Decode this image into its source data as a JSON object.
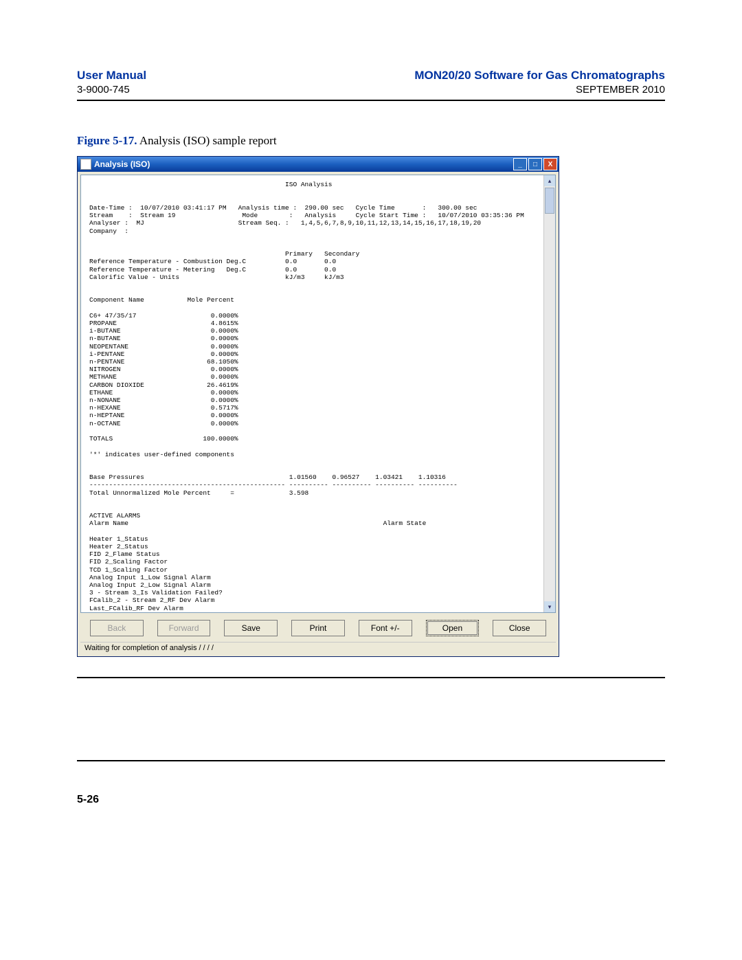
{
  "header": {
    "left_title": "User Manual",
    "left_sub": "3-9000-745",
    "right_title": "MON20/20 Software for Gas Chromatographs",
    "right_sub": "SEPTEMBER 2010"
  },
  "figure": {
    "num": "Figure 5-17.",
    "caption": "Analysis (ISO) sample report"
  },
  "window": {
    "title": "Analysis (ISO)"
  },
  "report": {
    "title": "ISO Analysis",
    "meta": {
      "date_time_label": "Date-Time :",
      "date_time": "10/07/2010 03:41:17 PM",
      "analysis_time_label": "Analysis time :",
      "analysis_time": "290.00 sec",
      "cycle_time_label": "Cycle Time",
      "cycle_time": "300.00 sec",
      "stream_label": "Stream",
      "stream": "Stream 19",
      "mode_label": "Mode",
      "mode": "Analysis",
      "cycle_start_label": "Cycle Start Time :",
      "cycle_start": "10/07/2010 03:35:36 PM",
      "analyser_label": "Analyser :",
      "analyser": "MJ",
      "stream_seq_label": "Stream Seq.",
      "stream_seq": "1,4,5,6,7,8,9,10,11,12,13,14,15,16,17,18,19,20",
      "company_label": "Company  :"
    },
    "ref_section": {
      "col_primary": "Primary",
      "col_secondary": "Secondary",
      "rows": [
        {
          "label": "Reference Temperature - Combustion Deg.C",
          "p": "0.0",
          "s": "0.0"
        },
        {
          "label": "Reference Temperature - Metering   Deg.C",
          "p": "0.0",
          "s": "0.0"
        },
        {
          "label": "Calorific Value - Units",
          "p": "kJ/m3",
          "s": "kJ/m3"
        }
      ]
    },
    "components": {
      "header_name": "Component Name",
      "header_mole": "Mole Percent",
      "rows": [
        {
          "n": "C6+ 47/35/17",
          "v": "0.0000%"
        },
        {
          "n": "PROPANE",
          "v": "4.8615%"
        },
        {
          "n": "i-BUTANE",
          "v": "0.0000%"
        },
        {
          "n": "n-BUTANE",
          "v": "0.0000%"
        },
        {
          "n": "NEOPENTANE",
          "v": "0.0000%"
        },
        {
          "n": "i-PENTANE",
          "v": "0.0000%"
        },
        {
          "n": "n-PENTANE",
          "v": "68.1050%"
        },
        {
          "n": "NITROGEN",
          "v": "0.0000%"
        },
        {
          "n": "METHANE",
          "v": "0.0000%"
        },
        {
          "n": "CARBON DIOXIDE",
          "v": "26.4619%"
        },
        {
          "n": "ETHANE",
          "v": "0.0000%"
        },
        {
          "n": "n-NONANE",
          "v": "0.0000%"
        },
        {
          "n": "n-HEXANE",
          "v": "0.5717%"
        },
        {
          "n": "n-HEPTANE",
          "v": "0.0000%"
        },
        {
          "n": "n-OCTANE",
          "v": "0.0000%"
        }
      ],
      "totals_label": "TOTALS",
      "totals_value": "100.0000%",
      "note": "'*' indicates user-defined components"
    },
    "base_pressures": {
      "label": "Base Pressures",
      "values": [
        "1.01560",
        "0.96527",
        "1.03421",
        "1.10316"
      ],
      "dashline": "-------------------------------------------------- ---------- ---------- ---------- ----------",
      "total_label": "Total Unnormalized Mole Percent     =",
      "total_value": "3.598"
    },
    "alarms": {
      "title": "ACTIVE ALARMS",
      "col_name": "Alarm Name",
      "col_state": "Alarm State",
      "rows": [
        "Heater 1_Status",
        "Heater 2_Status",
        "FID 2_Flame Status",
        "FID 2_Scaling Factor",
        "TCD 1_Scaling Factor",
        "Analog Input 1_Low Signal Alarm",
        "Analog Input 2_Low Signal Alarm",
        "3 - Stream 3_Is Validation Failed?",
        "FCalib_2 - Stream 2_RF Dev Alarm",
        "Last_FCalib_RF Dev Alarm"
      ]
    }
  },
  "buttons": {
    "back": "Back",
    "forward": "Forward",
    "save": "Save",
    "print": "Print",
    "font": "Font +/-",
    "open": "Open",
    "close": "Close"
  },
  "status": "Waiting for completion of analysis  / / / /",
  "page_num": "5-26"
}
